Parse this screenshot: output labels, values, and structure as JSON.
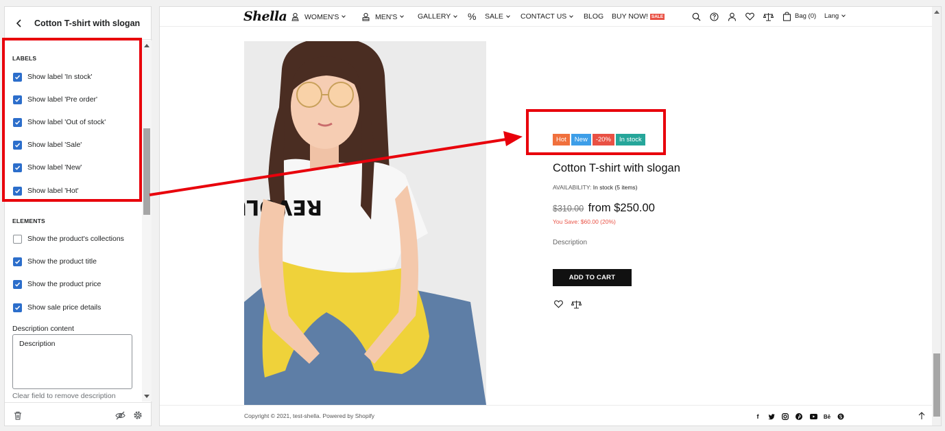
{
  "editor": {
    "title": "Cotton T-shirt with slogan",
    "labels_section": "LABELS",
    "labels": [
      {
        "label": "Show label 'In stock'",
        "checked": true
      },
      {
        "label": "Show label 'Pre order'",
        "checked": true
      },
      {
        "label": "Show label 'Out of stock'",
        "checked": true
      },
      {
        "label": "Show label 'Sale'",
        "checked": true
      },
      {
        "label": "Show label 'New'",
        "checked": true
      },
      {
        "label": "Show label 'Hot'",
        "checked": true
      }
    ],
    "elements_section": "ELEMENTS",
    "elements": [
      {
        "label": "Show the product's collections",
        "checked": false
      },
      {
        "label": "Show the product title",
        "checked": true
      },
      {
        "label": "Show the product price",
        "checked": true
      },
      {
        "label": "Show sale price details",
        "checked": true
      }
    ],
    "description_label": "Description content",
    "description_value": "Description",
    "description_help": "Clear field to remove description"
  },
  "store": {
    "logo": "Shella",
    "nav": [
      {
        "label": "WOMEN'S",
        "icon": "women-icon",
        "dropdown": true
      },
      {
        "label": "MEN'S",
        "icon": "men-icon",
        "dropdown": true
      },
      {
        "label": "GALLERY",
        "dropdown": true
      },
      {
        "label": "%",
        "icon": "percent-icon"
      },
      {
        "label": "SALE",
        "dropdown": true
      },
      {
        "label": "CONTACT US",
        "dropdown": true
      },
      {
        "label": "BLOG"
      },
      {
        "label": "BUY NOW!",
        "badge": "SALE"
      }
    ],
    "bag_label": "Bag (0)",
    "lang_label": "Lang"
  },
  "product": {
    "badges": [
      {
        "text": "Hot",
        "color": "#f0703d"
      },
      {
        "text": "New",
        "color": "#3d9ee8"
      },
      {
        "text": "-20%",
        "color": "#e95144"
      },
      {
        "text": "In stock",
        "color": "#26a69a"
      }
    ],
    "title": "Cotton T-shirt with slogan",
    "availability_label": "AVAILABILITY:",
    "availability_value": "In stock (5 items)",
    "old_price": "$310.00",
    "price": "from $250.00",
    "you_save": "You Save: $60.00 (20%)",
    "description": "Description",
    "add_to_cart": "ADD TO CART",
    "tshirt_print": "REVOLUTI"
  },
  "footer": {
    "copyright": "Copyright © 2021, test-shella. Powered by Shopify"
  },
  "colors": {
    "accent": "#2c6ecb",
    "highlight": "#e8000b",
    "sale": "#e95144"
  }
}
